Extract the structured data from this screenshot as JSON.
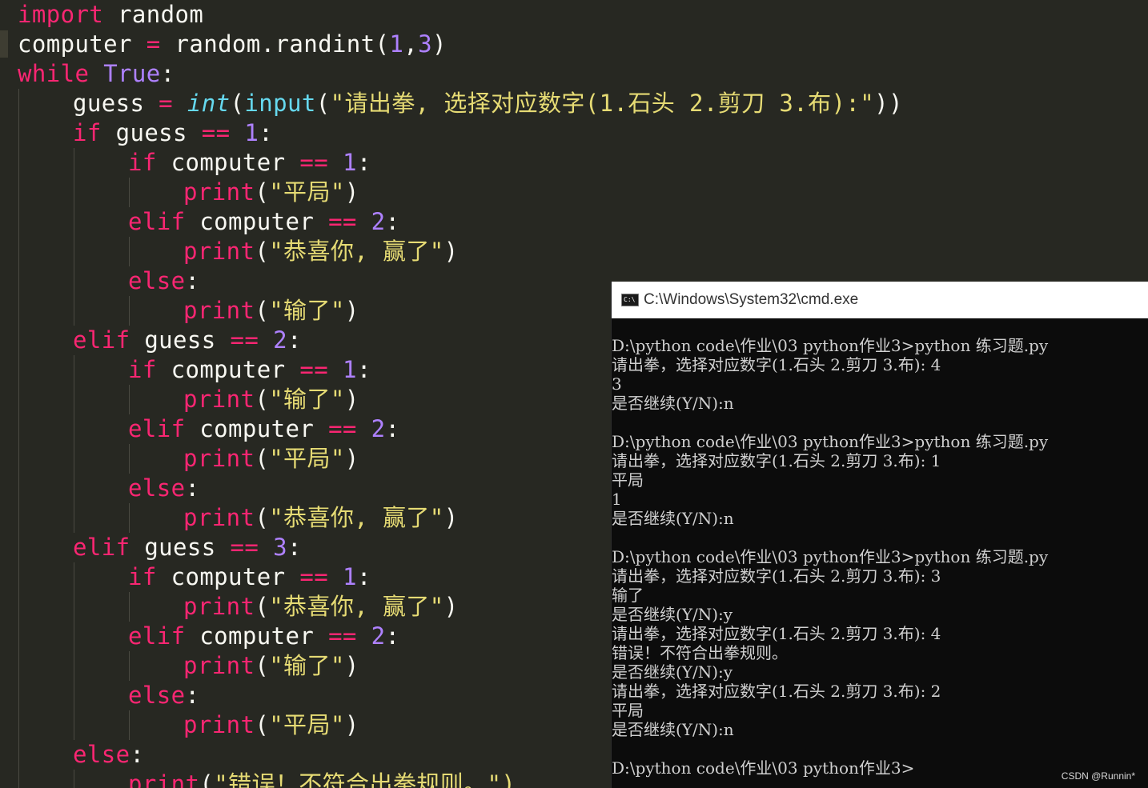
{
  "editor": {
    "lines": [
      {
        "indent": 0,
        "tokens": [
          {
            "t": "import",
            "c": "kw"
          },
          {
            "t": " random",
            "c": "plain"
          }
        ]
      },
      {
        "indent": 0,
        "tokens": [
          {
            "t": "computer ",
            "c": "plain"
          },
          {
            "t": "=",
            "c": "op"
          },
          {
            "t": " random.randint(",
            "c": "plain"
          },
          {
            "t": "1",
            "c": "const"
          },
          {
            "t": ",",
            "c": "plain"
          },
          {
            "t": "3",
            "c": "const"
          },
          {
            "t": ")",
            "c": "plain"
          }
        ]
      },
      {
        "indent": 0,
        "tokens": [
          {
            "t": "while",
            "c": "kw"
          },
          {
            "t": " ",
            "c": "plain"
          },
          {
            "t": "True",
            "c": "const"
          },
          {
            "t": ":",
            "c": "plain"
          }
        ]
      },
      {
        "indent": 1,
        "tokens": [
          {
            "t": "guess ",
            "c": "plain"
          },
          {
            "t": "=",
            "c": "op"
          },
          {
            "t": " ",
            "c": "plain"
          },
          {
            "t": "int",
            "c": "fni"
          },
          {
            "t": "(",
            "c": "plain"
          },
          {
            "t": "input",
            "c": "fn"
          },
          {
            "t": "(",
            "c": "plain"
          },
          {
            "t": "\"请出拳, 选择对应数字(1.石头 2.剪刀 3.布):\"",
            "c": "str"
          },
          {
            "t": "))",
            "c": "plain"
          }
        ]
      },
      {
        "indent": 1,
        "tokens": [
          {
            "t": "if",
            "c": "kw"
          },
          {
            "t": " guess ",
            "c": "plain"
          },
          {
            "t": "==",
            "c": "op"
          },
          {
            "t": " ",
            "c": "plain"
          },
          {
            "t": "1",
            "c": "const"
          },
          {
            "t": ":",
            "c": "plain"
          }
        ]
      },
      {
        "indent": 2,
        "tokens": [
          {
            "t": "if",
            "c": "kw"
          },
          {
            "t": " computer ",
            "c": "plain"
          },
          {
            "t": "==",
            "c": "op"
          },
          {
            "t": " ",
            "c": "plain"
          },
          {
            "t": "1",
            "c": "const"
          },
          {
            "t": ":",
            "c": "plain"
          }
        ]
      },
      {
        "indent": 3,
        "tokens": [
          {
            "t": "print",
            "c": "kw"
          },
          {
            "t": "(",
            "c": "plain"
          },
          {
            "t": "\"平局\"",
            "c": "str"
          },
          {
            "t": ")",
            "c": "plain"
          }
        ]
      },
      {
        "indent": 2,
        "tokens": [
          {
            "t": "elif",
            "c": "kw"
          },
          {
            "t": " computer ",
            "c": "plain"
          },
          {
            "t": "==",
            "c": "op"
          },
          {
            "t": " ",
            "c": "plain"
          },
          {
            "t": "2",
            "c": "const"
          },
          {
            "t": ":",
            "c": "plain"
          }
        ]
      },
      {
        "indent": 3,
        "tokens": [
          {
            "t": "print",
            "c": "kw"
          },
          {
            "t": "(",
            "c": "plain"
          },
          {
            "t": "\"恭喜你, 赢了\"",
            "c": "str"
          },
          {
            "t": ")",
            "c": "plain"
          }
        ]
      },
      {
        "indent": 2,
        "tokens": [
          {
            "t": "else",
            "c": "kw"
          },
          {
            "t": ":",
            "c": "plain"
          }
        ]
      },
      {
        "indent": 3,
        "tokens": [
          {
            "t": "print",
            "c": "kw"
          },
          {
            "t": "(",
            "c": "plain"
          },
          {
            "t": "\"输了\"",
            "c": "str"
          },
          {
            "t": ")",
            "c": "plain"
          }
        ]
      },
      {
        "indent": 1,
        "tokens": [
          {
            "t": "elif",
            "c": "kw"
          },
          {
            "t": " guess ",
            "c": "plain"
          },
          {
            "t": "==",
            "c": "op"
          },
          {
            "t": " ",
            "c": "plain"
          },
          {
            "t": "2",
            "c": "const"
          },
          {
            "t": ":",
            "c": "plain"
          }
        ]
      },
      {
        "indent": 2,
        "tokens": [
          {
            "t": "if",
            "c": "kw"
          },
          {
            "t": " computer ",
            "c": "plain"
          },
          {
            "t": "==",
            "c": "op"
          },
          {
            "t": " ",
            "c": "plain"
          },
          {
            "t": "1",
            "c": "const"
          },
          {
            "t": ":",
            "c": "plain"
          }
        ]
      },
      {
        "indent": 3,
        "tokens": [
          {
            "t": "print",
            "c": "kw"
          },
          {
            "t": "(",
            "c": "plain"
          },
          {
            "t": "\"输了\"",
            "c": "str"
          },
          {
            "t": ")",
            "c": "plain"
          }
        ]
      },
      {
        "indent": 2,
        "tokens": [
          {
            "t": "elif",
            "c": "kw"
          },
          {
            "t": " computer ",
            "c": "plain"
          },
          {
            "t": "==",
            "c": "op"
          },
          {
            "t": " ",
            "c": "plain"
          },
          {
            "t": "2",
            "c": "const"
          },
          {
            "t": ":",
            "c": "plain"
          }
        ]
      },
      {
        "indent": 3,
        "tokens": [
          {
            "t": "print",
            "c": "kw"
          },
          {
            "t": "(",
            "c": "plain"
          },
          {
            "t": "\"平局\"",
            "c": "str"
          },
          {
            "t": ")",
            "c": "plain"
          }
        ]
      },
      {
        "indent": 2,
        "tokens": [
          {
            "t": "else",
            "c": "kw"
          },
          {
            "t": ":",
            "c": "plain"
          }
        ]
      },
      {
        "indent": 3,
        "tokens": [
          {
            "t": "print",
            "c": "kw"
          },
          {
            "t": "(",
            "c": "plain"
          },
          {
            "t": "\"恭喜你, 赢了\"",
            "c": "str"
          },
          {
            "t": ")",
            "c": "plain"
          }
        ]
      },
      {
        "indent": 1,
        "tokens": [
          {
            "t": "elif",
            "c": "kw"
          },
          {
            "t": " guess ",
            "c": "plain"
          },
          {
            "t": "==",
            "c": "op"
          },
          {
            "t": " ",
            "c": "plain"
          },
          {
            "t": "3",
            "c": "const"
          },
          {
            "t": ":",
            "c": "plain"
          }
        ]
      },
      {
        "indent": 2,
        "tokens": [
          {
            "t": "if",
            "c": "kw"
          },
          {
            "t": " computer ",
            "c": "plain"
          },
          {
            "t": "==",
            "c": "op"
          },
          {
            "t": " ",
            "c": "plain"
          },
          {
            "t": "1",
            "c": "const"
          },
          {
            "t": ":",
            "c": "plain"
          }
        ]
      },
      {
        "indent": 3,
        "tokens": [
          {
            "t": "print",
            "c": "kw"
          },
          {
            "t": "(",
            "c": "plain"
          },
          {
            "t": "\"恭喜你, 赢了\"",
            "c": "str"
          },
          {
            "t": ")",
            "c": "plain"
          }
        ]
      },
      {
        "indent": 2,
        "tokens": [
          {
            "t": "elif",
            "c": "kw"
          },
          {
            "t": " computer ",
            "c": "plain"
          },
          {
            "t": "==",
            "c": "op"
          },
          {
            "t": " ",
            "c": "plain"
          },
          {
            "t": "2",
            "c": "const"
          },
          {
            "t": ":",
            "c": "plain"
          }
        ]
      },
      {
        "indent": 3,
        "tokens": [
          {
            "t": "print",
            "c": "kw"
          },
          {
            "t": "(",
            "c": "plain"
          },
          {
            "t": "\"输了\"",
            "c": "str"
          },
          {
            "t": ")",
            "c": "plain"
          }
        ]
      },
      {
        "indent": 2,
        "tokens": [
          {
            "t": "else",
            "c": "kw"
          },
          {
            "t": ":",
            "c": "plain"
          }
        ]
      },
      {
        "indent": 3,
        "tokens": [
          {
            "t": "print",
            "c": "kw"
          },
          {
            "t": "(",
            "c": "plain"
          },
          {
            "t": "\"平局\"",
            "c": "str"
          },
          {
            "t": ")",
            "c": "plain"
          }
        ]
      },
      {
        "indent": 1,
        "tokens": [
          {
            "t": "else",
            "c": "kw"
          },
          {
            "t": ":",
            "c": "plain"
          }
        ]
      },
      {
        "indent": 2,
        "tokens": [
          {
            "t": "print",
            "c": "kw"
          },
          {
            "t": "(",
            "c": "plain"
          },
          {
            "t": "\"错误！不符合出拳规则。\")",
            "c": "str"
          }
        ]
      }
    ]
  },
  "cmd": {
    "title": "C:\\Windows\\System32\\cmd.exe",
    "icon_label": "C:\\",
    "lines": [
      "D:\\python code\\作业\\03 python作业3>python 练习题.py",
      "请出拳，选择对应数字(1.石头 2.剪刀 3.布): 4",
      "3",
      "是否继续(Y/N):n",
      "",
      "D:\\python code\\作业\\03 python作业3>python 练习题.py",
      "请出拳，选择对应数字(1.石头 2.剪刀 3.布): 1",
      "平局",
      "1",
      "是否继续(Y/N):n",
      "",
      "D:\\python code\\作业\\03 python作业3>python 练习题.py",
      "请出拳，选择对应数字(1.石头 2.剪刀 3.布): 3",
      "输了",
      "是否继续(Y/N):y",
      "请出拳，选择对应数字(1.石头 2.剪刀 3.布): 4",
      "错误！不符合出拳规则。",
      "是否继续(Y/N):y",
      "请出拳，选择对应数字(1.石头 2.剪刀 3.布): 2",
      "平局",
      "是否继续(Y/N):n",
      "",
      "D:\\python code\\作业\\03 python作业3>"
    ]
  },
  "watermark": "CSDN @Runnin*"
}
